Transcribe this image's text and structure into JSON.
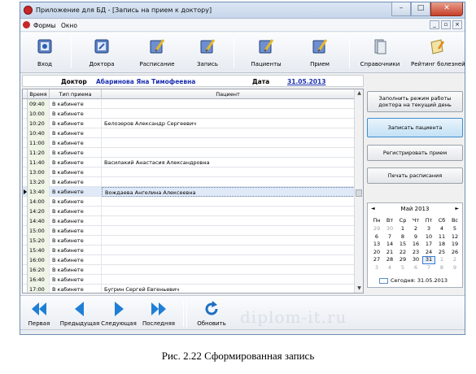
{
  "window": {
    "title": "Приложение для БД - [Запись на прием к доктору]"
  },
  "menu": {
    "items": [
      "Формы",
      "Окно"
    ]
  },
  "mdi_controls": [
    "_",
    "▫",
    "×"
  ],
  "toolbar": {
    "buttons": [
      {
        "label": "Вход",
        "icon": "login-icon"
      },
      {
        "label": "Доктора",
        "icon": "doctors-icon"
      },
      {
        "label": "Расписание",
        "icon": "schedule-icon"
      },
      {
        "label": "Запись",
        "icon": "appointment-icon"
      },
      {
        "label": "Пациенты",
        "icon": "patients-icon"
      },
      {
        "label": "Прием",
        "icon": "reception-icon"
      },
      {
        "label": "Справочники",
        "icon": "reference-books-icon"
      },
      {
        "label": "Рейтинг болезней",
        "icon": "disease-rating-icon"
      }
    ]
  },
  "doctor_bar": {
    "doctor_label": "Доктор",
    "doctor_name": "Абаринова Яна Тимофеевна",
    "date_label": "Дата",
    "date_value": "31.05.2013"
  },
  "grid": {
    "columns": [
      "Время",
      "Тип приема",
      "Пациент"
    ],
    "rows": [
      {
        "time": "09:40",
        "type": "В кабинете",
        "patient": ""
      },
      {
        "time": "10:00",
        "type": "В кабинете",
        "patient": ""
      },
      {
        "time": "10:20",
        "type": "В кабинете",
        "patient": "Белозеров Александр Сергеевич"
      },
      {
        "time": "10:40",
        "type": "В кабинете",
        "patient": ""
      },
      {
        "time": "11:00",
        "type": "В кабинете",
        "patient": ""
      },
      {
        "time": "11:20",
        "type": "В кабинете",
        "patient": ""
      },
      {
        "time": "11:40",
        "type": "В кабинете",
        "patient": "Василакий Анастасия Александровна"
      },
      {
        "time": "13:00",
        "type": "В кабинете",
        "patient": ""
      },
      {
        "time": "13:20",
        "type": "В кабинете",
        "patient": ""
      },
      {
        "time": "13:40",
        "type": "В кабинете",
        "patient": "Вождаева Ангелина Алексеевна",
        "selected": true
      },
      {
        "time": "14:00",
        "type": "В кабинете",
        "patient": ""
      },
      {
        "time": "14:20",
        "type": "В кабинете",
        "patient": ""
      },
      {
        "time": "14:40",
        "type": "В кабинете",
        "patient": ""
      },
      {
        "time": "15:00",
        "type": "В кабинете",
        "patient": ""
      },
      {
        "time": "15:20",
        "type": "В кабинете",
        "patient": ""
      },
      {
        "time": "15:40",
        "type": "В кабинете",
        "patient": ""
      },
      {
        "time": "16:00",
        "type": "В кабинете",
        "patient": ""
      },
      {
        "time": "16:20",
        "type": "В кабинете",
        "patient": ""
      },
      {
        "time": "16:40",
        "type": "В кабинете",
        "patient": ""
      },
      {
        "time": "17:00",
        "type": "В кабинете",
        "patient": "Бугрин Сергей Евгеньевич"
      }
    ]
  },
  "actions": {
    "fill_schedule": "Заполнить режим работы доктора на текущий день",
    "book_patient": "Записать пациента",
    "register_visit": "Регистрировать прием",
    "print_schedule": "Печать расписания"
  },
  "calendar": {
    "month_title": "Май 2013",
    "weekdays": [
      "Пн",
      "Вт",
      "Ср",
      "Чт",
      "Пт",
      "Сб",
      "Вс"
    ],
    "days": [
      {
        "d": "29",
        "other": true
      },
      {
        "d": "30",
        "other": true
      },
      {
        "d": "1"
      },
      {
        "d": "2"
      },
      {
        "d": "3"
      },
      {
        "d": "4"
      },
      {
        "d": "5"
      },
      {
        "d": "6"
      },
      {
        "d": "7"
      },
      {
        "d": "8"
      },
      {
        "d": "9"
      },
      {
        "d": "10"
      },
      {
        "d": "11"
      },
      {
        "d": "12"
      },
      {
        "d": "13"
      },
      {
        "d": "14"
      },
      {
        "d": "15"
      },
      {
        "d": "16"
      },
      {
        "d": "17"
      },
      {
        "d": "18"
      },
      {
        "d": "19"
      },
      {
        "d": "20"
      },
      {
        "d": "21"
      },
      {
        "d": "22"
      },
      {
        "d": "23"
      },
      {
        "d": "24"
      },
      {
        "d": "25"
      },
      {
        "d": "26"
      },
      {
        "d": "27"
      },
      {
        "d": "28"
      },
      {
        "d": "29"
      },
      {
        "d": "30"
      },
      {
        "d": "31",
        "today": true
      },
      {
        "d": "1",
        "other": true
      },
      {
        "d": "2",
        "other": true
      },
      {
        "d": "3",
        "other": true
      },
      {
        "d": "4",
        "other": true
      },
      {
        "d": "5",
        "other": true
      },
      {
        "d": "6",
        "other": true
      },
      {
        "d": "7",
        "other": true
      },
      {
        "d": "8",
        "other": true
      },
      {
        "d": "9",
        "other": true
      }
    ],
    "today_label": "Сегодня: 31.05.2013"
  },
  "navigator": {
    "first": "Первая",
    "prev": "Предыдущая",
    "next": "Следующая",
    "last": "Последняя",
    "refresh": "Обновить"
  },
  "watermark": "diplom-it.ru",
  "caption": "Рис. 2.22 Сформированная запись",
  "colors": {
    "accent_blue": "#1b2fb0",
    "nav_arrow": "#1f7fd6",
    "selected_row": "#dfe9f8"
  }
}
